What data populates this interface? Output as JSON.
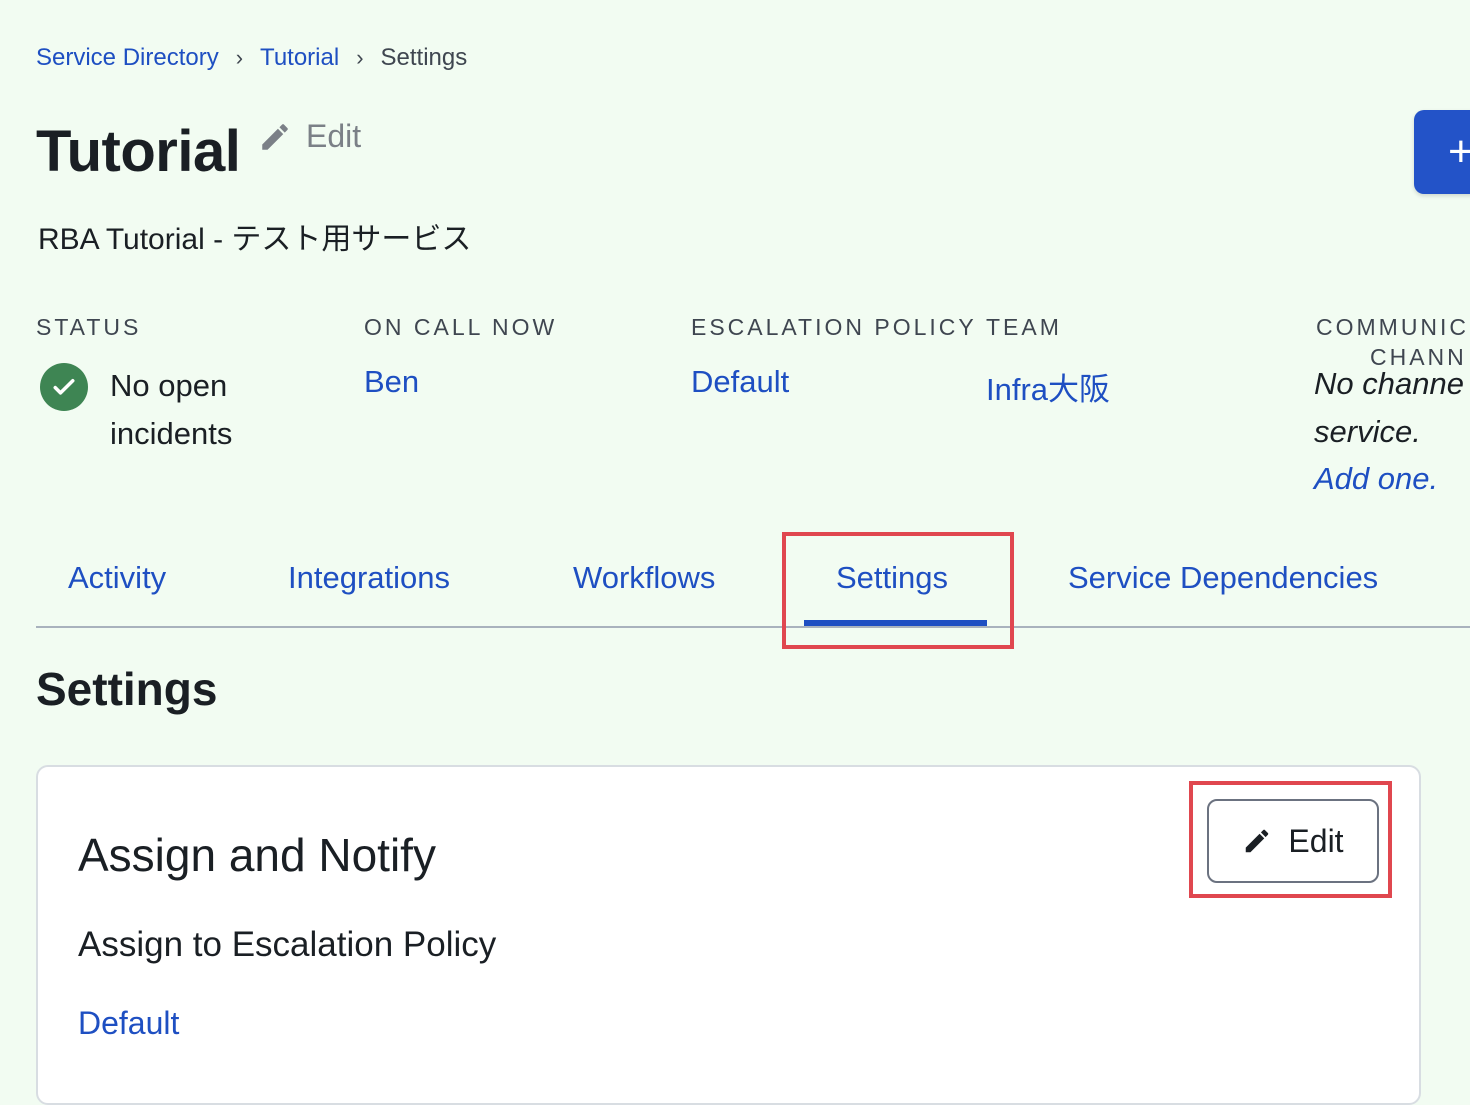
{
  "breadcrumb": {
    "items": [
      "Service Directory",
      "Tutorial",
      "Settings"
    ],
    "separator": "›"
  },
  "header": {
    "title": "Tutorial",
    "edit_label": "Edit",
    "description": "RBA Tutorial - テスト用サービス",
    "primary_button_label": "+"
  },
  "stats": {
    "status": {
      "label": "STATUS",
      "value": "No open incidents"
    },
    "on_call": {
      "label": "ON CALL NOW",
      "value": "Ben"
    },
    "escalation": {
      "label": "ESCALATION POLICY",
      "value": "Default"
    },
    "team": {
      "label": "TEAM",
      "value": "Infra大阪"
    },
    "communication": {
      "label_line1": "COMMUNIC",
      "label_line2": "CHANN",
      "text_line1": "No channe",
      "text_line2": "service.",
      "link": "Add one."
    }
  },
  "tabs": [
    {
      "label": "Activity"
    },
    {
      "label": "Integrations"
    },
    {
      "label": "Workflows"
    },
    {
      "label": "Settings",
      "active": true
    },
    {
      "label": "Service Dependencies"
    }
  ],
  "settings": {
    "section_title": "Settings",
    "card": {
      "title": "Assign and Notify",
      "edit_label": "Edit",
      "subtitle": "Assign to Escalation Policy",
      "policy_link": "Default"
    }
  },
  "colors": {
    "background": "#f2fcf2",
    "link": "#1e4fc2",
    "primary_button": "#2353c8",
    "status_ok": "#3e8553",
    "annotation": "#e0474f"
  }
}
